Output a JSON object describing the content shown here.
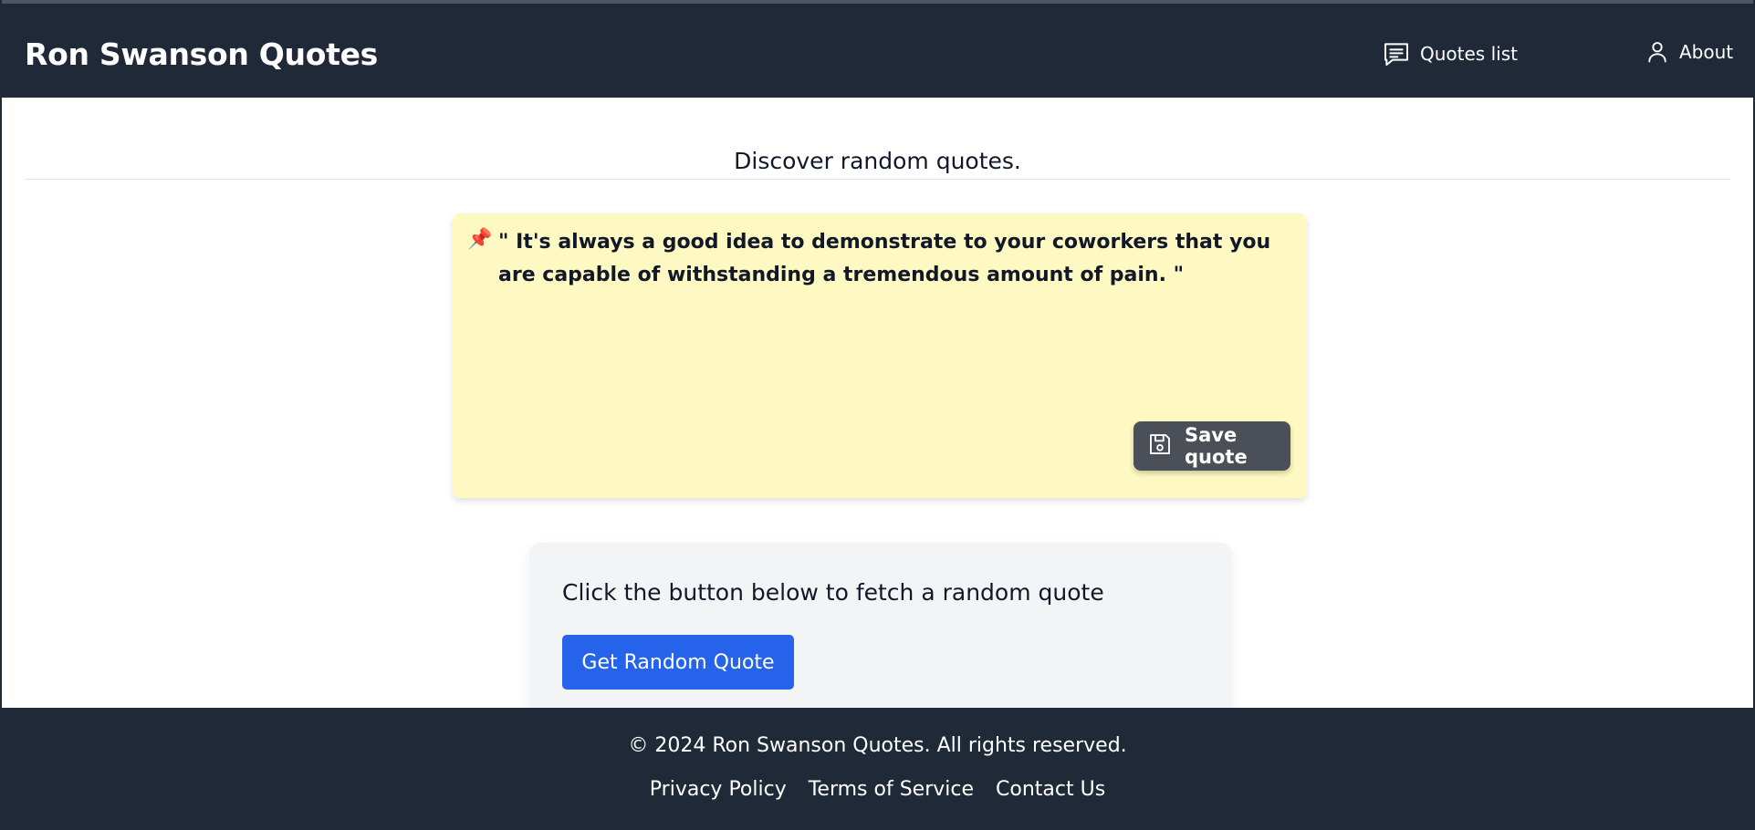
{
  "header": {
    "brand": "Ron Swanson Quotes",
    "nav": [
      {
        "label": "Quotes list",
        "icon": "chat-bubble-icon"
      },
      {
        "label": "About",
        "icon": "user-icon"
      }
    ]
  },
  "main": {
    "tagline": "Discover random quotes.",
    "quote": {
      "pin_icon": "📌",
      "text": "\" It's always a good idea to demonstrate to your coworkers that you are capable of withstanding a tremendous amount of pain. \"",
      "save_label": "Save quote",
      "save_icon": "floppy-disk-icon"
    },
    "fetch": {
      "prompt": "Click the button below to fetch a random quote",
      "button_label": "Get Random Quote"
    }
  },
  "footer": {
    "copyright": "© 2024 Ron Swanson Quotes. All rights reserved.",
    "links": [
      "Privacy Policy",
      "Terms of Service",
      "Contact Us"
    ]
  },
  "colors": {
    "nav_bg": "#1f2937",
    "quote_card_bg": "#fef8c2",
    "save_button_bg": "#4b4f58",
    "primary_button_bg": "#2563eb",
    "fetch_card_bg": "#f3f4f6"
  }
}
